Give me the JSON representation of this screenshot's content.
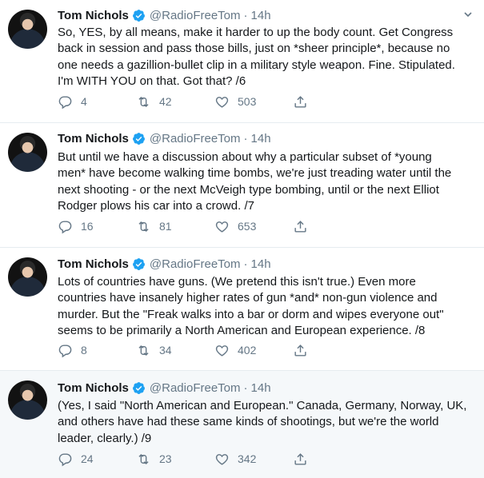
{
  "tweets": [
    {
      "name": "Tom Nichols",
      "handle": "@RadioFreeTom",
      "separator": "·",
      "time": "14h",
      "lines": [
        "So, YES, by all means, make it harder to up the body count. Get Congress",
        "back in session and pass those bills, just on *sheer principle*, because no",
        "one needs a gazillion-bullet clip in a military style weapon. Fine. Stipulated.",
        "I'm WITH YOU on that. Got that? /6"
      ],
      "replies": "4",
      "retweets": "42",
      "likes": "503"
    },
    {
      "name": "Tom Nichols",
      "handle": "@RadioFreeTom",
      "separator": "·",
      "time": "14h",
      "lines": [
        "But until we have a discussion about why a particular subset of *young",
        "men* have become walking time bombs, we're just treading water until the",
        "next shooting - or the next McVeigh type bombing, until or the next Elliot",
        "Rodger plows his car into a crowd. /7"
      ],
      "replies": "16",
      "retweets": "81",
      "likes": "653"
    },
    {
      "name": "Tom Nichols",
      "handle": "@RadioFreeTom",
      "separator": "·",
      "time": "14h",
      "lines": [
        "Lots of countries have guns. (We pretend this isn't true.) Even more",
        "countries have insanely higher rates of gun *and* non-gun violence and",
        "murder. But the \"Freak walks into a bar or dorm and wipes everyone out\"",
        "seems to be primarily a North American and European experience. /8"
      ],
      "replies": "8",
      "retweets": "34",
      "likes": "402"
    },
    {
      "name": "Tom Nichols",
      "handle": "@RadioFreeTom",
      "separator": "·",
      "time": "14h",
      "lines": [
        "(Yes, I said \"North American and European.\" Canada, Germany, Norway, UK,",
        "and others have had these same kinds of shootings, but we're the world",
        "leader, clearly.) /9"
      ],
      "replies": "24",
      "retweets": "23",
      "likes": "342"
    }
  ],
  "icons": {
    "verified": "verified-badge-icon",
    "caret": "chevron-down-icon",
    "reply": "reply-icon",
    "retweet": "retweet-icon",
    "like": "heart-icon",
    "share": "share-icon"
  },
  "colors": {
    "verified": "#1da1f2",
    "secondary_text": "#657786",
    "highlight_bg": "#f5f8fa"
  }
}
